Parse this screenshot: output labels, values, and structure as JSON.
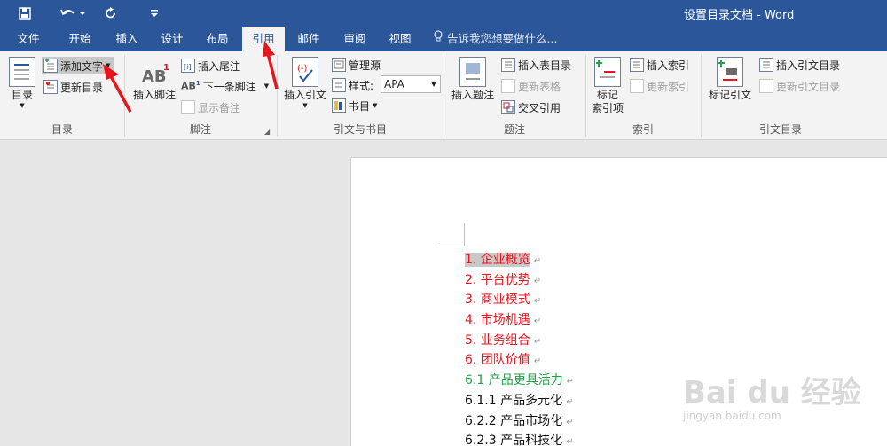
{
  "window": {
    "title": "设置目录文档 - Word"
  },
  "qat": {
    "save_icon": "save-icon",
    "undo_icon": "undo-icon",
    "redo_icon": "redo-icon",
    "customize_icon": "customize-qat-icon"
  },
  "tabs": [
    {
      "label": "文件"
    },
    {
      "label": "开始"
    },
    {
      "label": "插入"
    },
    {
      "label": "设计"
    },
    {
      "label": "布局"
    },
    {
      "label": "引用"
    },
    {
      "label": "邮件"
    },
    {
      "label": "审阅"
    },
    {
      "label": "视图"
    }
  ],
  "active_tab": "引用",
  "tell_me": {
    "placeholder": "告诉我您想要做什么..."
  },
  "ribbon": {
    "toc_group": {
      "label": "目录",
      "toc_button": "目录",
      "add_text": "添加文字",
      "update_toc": "更新目录"
    },
    "footnotes_group": {
      "label": "脚注",
      "insert_footnote": "插入脚注",
      "insert_endnote": "插入尾注",
      "next_footnote": "下一条脚注",
      "show_notes": "显示备注"
    },
    "citations_group": {
      "label": "引文与书目",
      "insert_citation": "插入引文",
      "manage_sources": "管理源",
      "style_label": "样式:",
      "style_value": "APA",
      "bibliography": "书目"
    },
    "captions_group": {
      "label": "题注",
      "insert_caption": "插入题注",
      "insert_table_of_figures": "插入表目录",
      "update_table": "更新表格",
      "cross_reference": "交叉引用"
    },
    "index_group": {
      "label": "索引",
      "mark_entry": "标记\n索引项",
      "insert_index": "插入索引",
      "update_index": "更新索引"
    },
    "authorities_group": {
      "label": "引文目录",
      "mark_citation": "标记引文",
      "insert_table_of_authorities": "插入引文目录",
      "update_table": "更新引文目录"
    }
  },
  "document": {
    "lines": [
      {
        "text": "1. 企业概览",
        "color": "#e8141c",
        "selected": true
      },
      {
        "text": "2. 平台优势",
        "color": "#e8141c",
        "selected": false
      },
      {
        "text": "3. 商业模式",
        "color": "#e8141c",
        "selected": false
      },
      {
        "text": "4. 市场机遇",
        "color": "#e8141c",
        "selected": false
      },
      {
        "text": "5. 业务组合",
        "color": "#e8141c",
        "selected": false
      },
      {
        "text": "6. 团队价值",
        "color": "#e8141c",
        "selected": false
      },
      {
        "text": "6.1 产品更具活力",
        "color": "#22a04a",
        "selected": false
      },
      {
        "text": "6.1.1 产品多元化",
        "color": "#111111",
        "selected": false
      },
      {
        "text": "6.2.2 产品市场化",
        "color": "#111111",
        "selected": false
      },
      {
        "text": "6.2.3 产品科技化",
        "color": "#111111",
        "selected": false
      }
    ],
    "paragraph_mark": "↵"
  },
  "watermark": {
    "brand": "Bai du 经验",
    "url": "jingyan.baidu.com"
  },
  "colors": {
    "accent": "#2b579a",
    "annotation_arrow": "#e8141c"
  }
}
